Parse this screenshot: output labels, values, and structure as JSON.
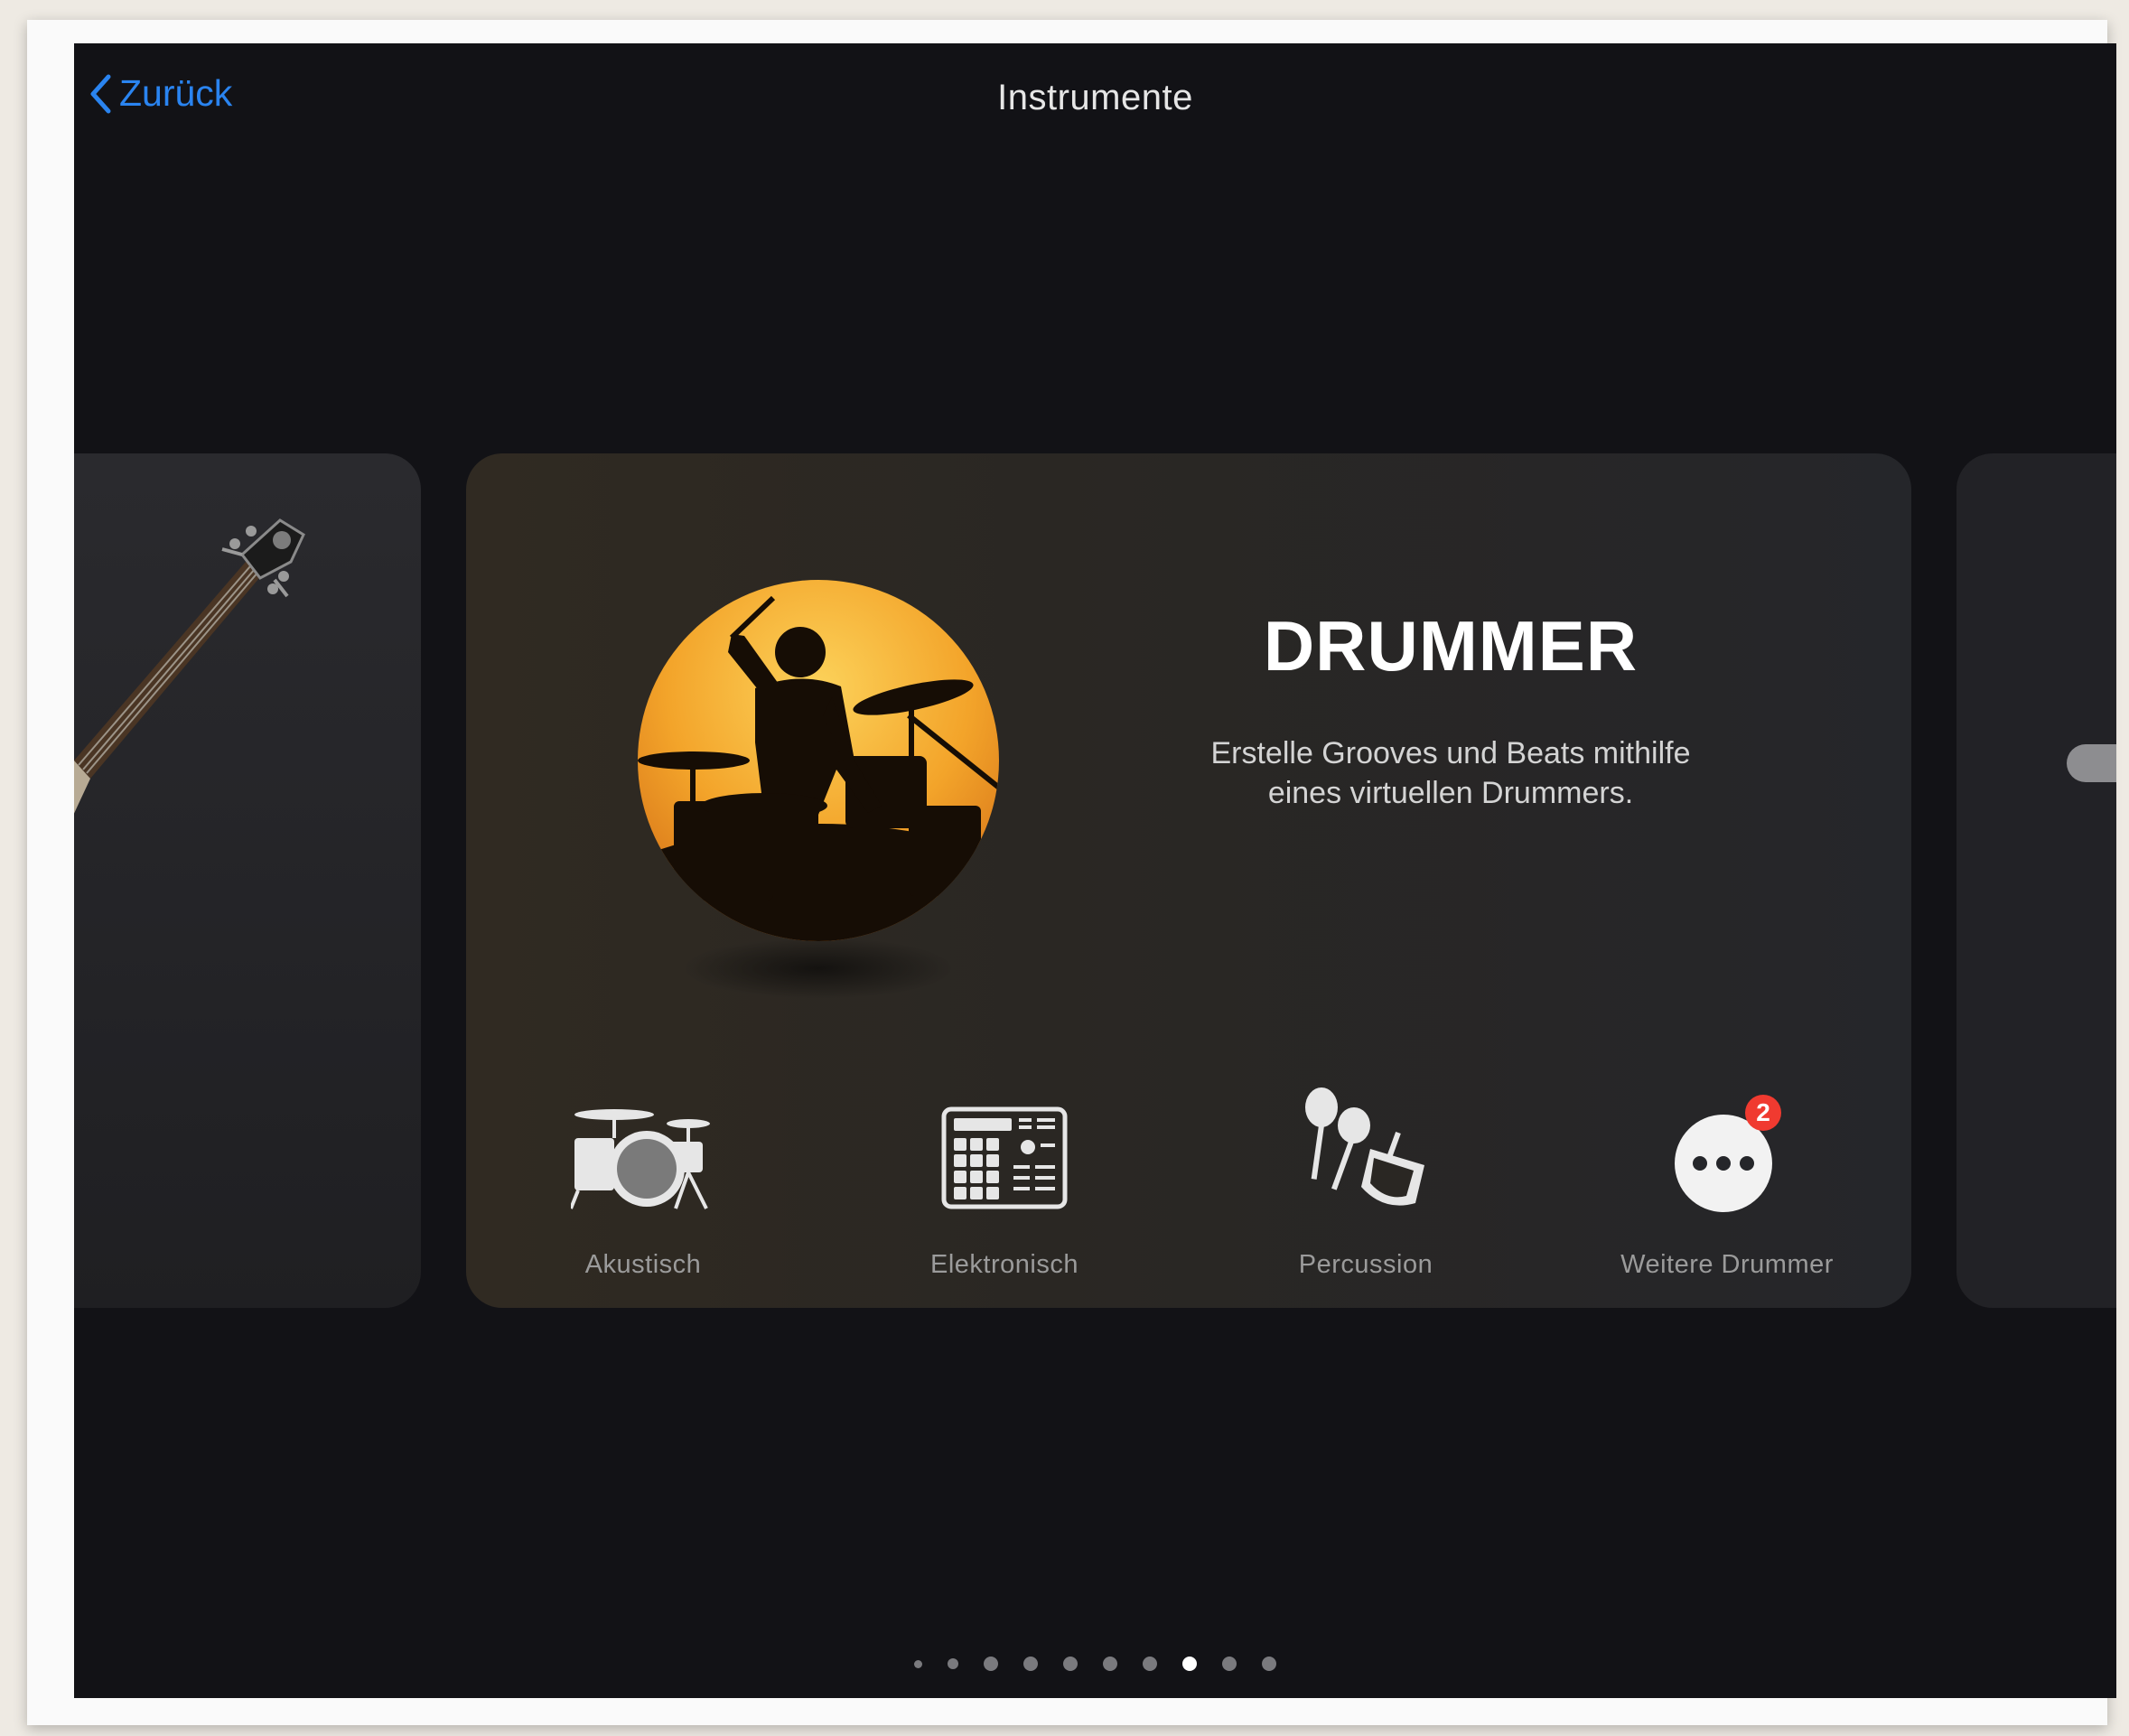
{
  "nav": {
    "back_label": "Zurück",
    "title": "Instrumente"
  },
  "card": {
    "title": "DRUMMER",
    "description": "Erstelle Grooves und Beats mithilfe eines virtuellen Drummers.",
    "categories": [
      {
        "label": "Akustisch",
        "icon": "acoustic-drumkit-icon"
      },
      {
        "label": "Elektronisch",
        "icon": "drum-machine-icon"
      },
      {
        "label": "Percussion",
        "icon": "percussion-icon"
      },
      {
        "label": "Weitere Drummer",
        "icon": "more-icon",
        "badge": "2"
      }
    ]
  },
  "pager": {
    "count": 10,
    "active_index": 7
  },
  "colors": {
    "accent": "#2a84f0",
    "badge": "#f03a30",
    "background": "#121216",
    "sun": "#f3a42a"
  }
}
